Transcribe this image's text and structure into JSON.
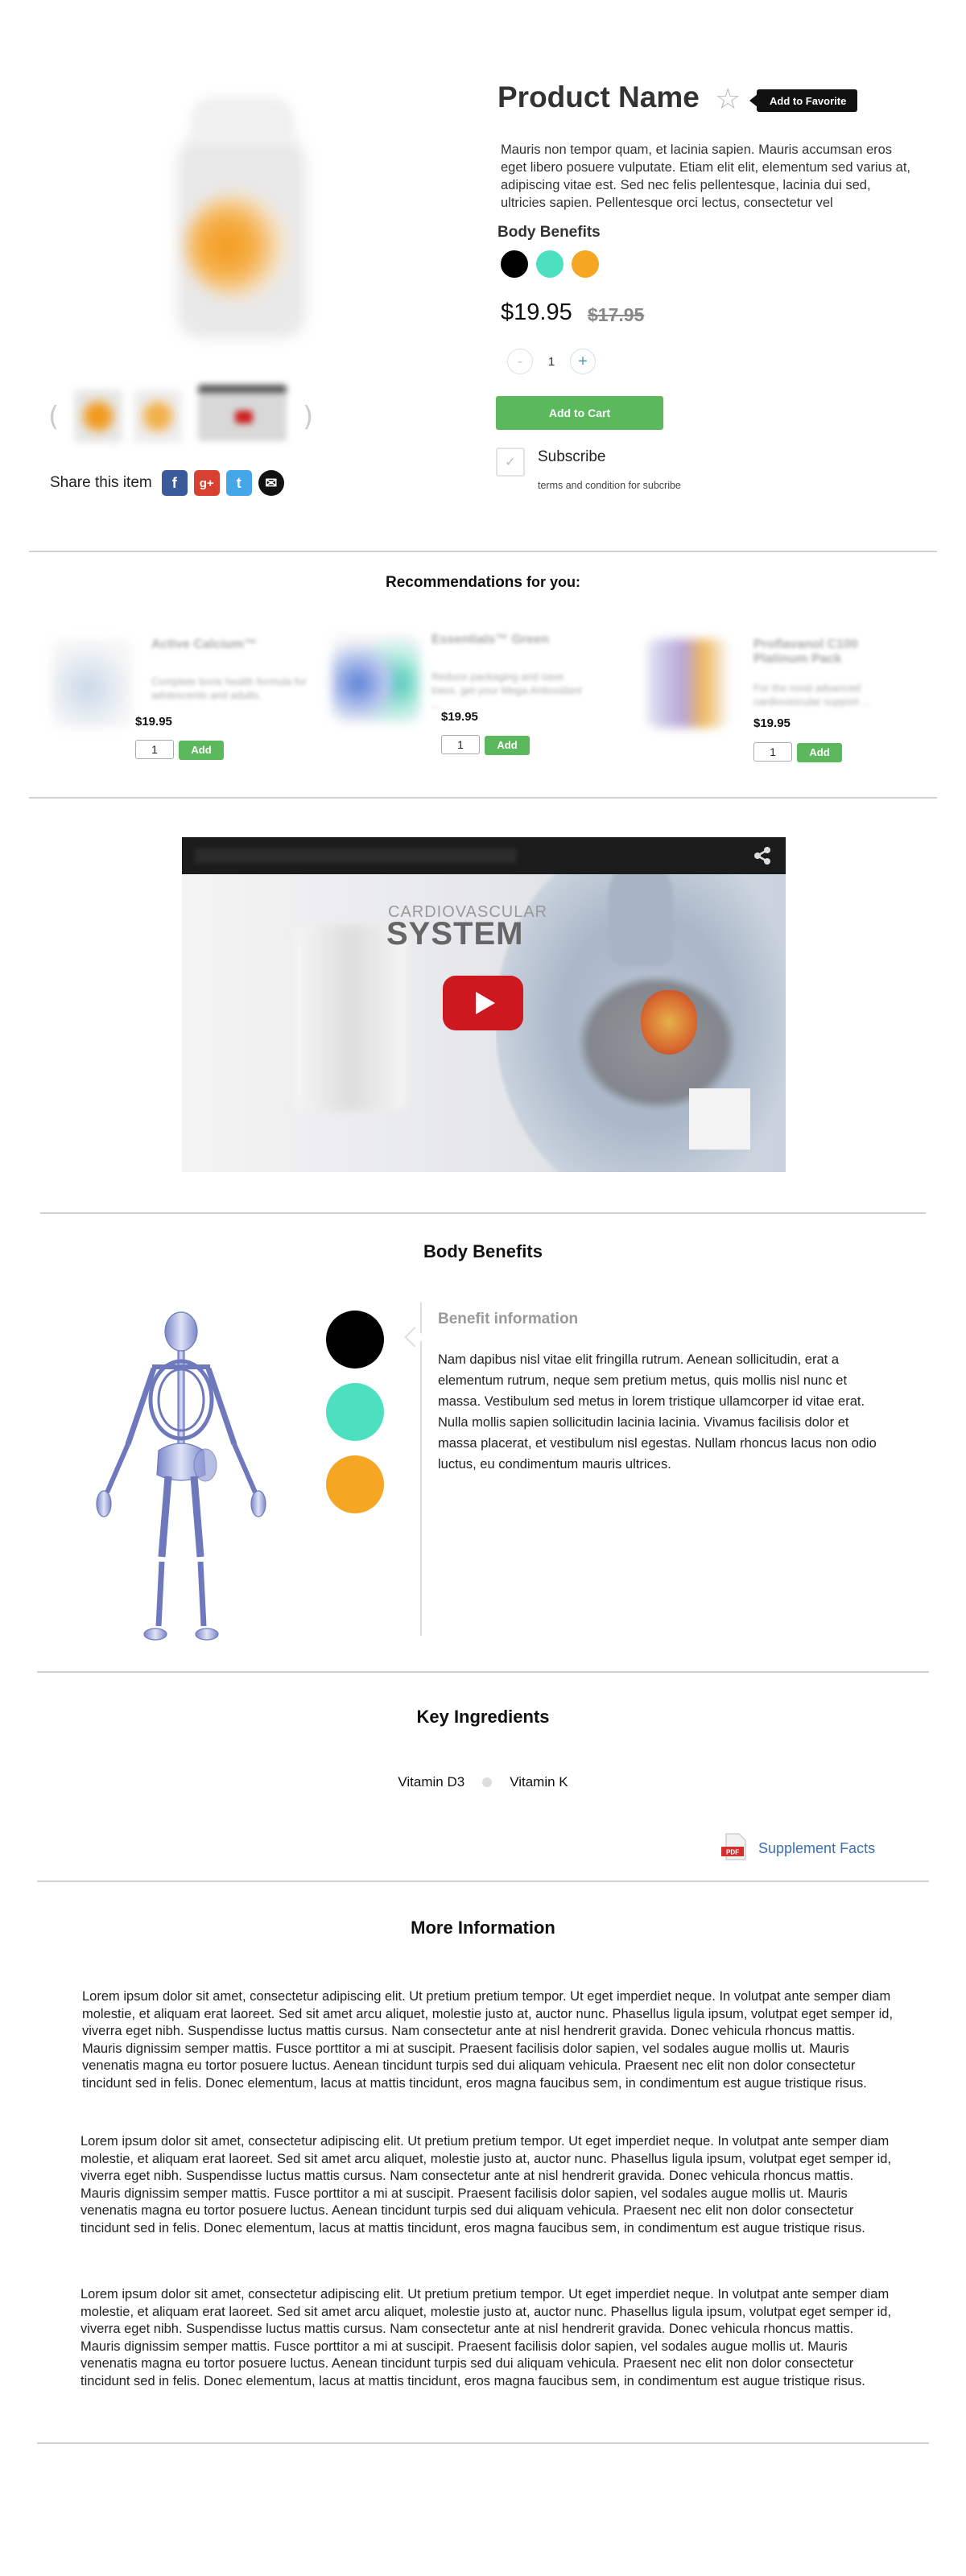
{
  "product": {
    "name": "Product Name",
    "favorite_label": "Add to Favorite",
    "description": "Mauris non tempor quam, et lacinia sapien. Mauris accumsan eros eget libero posuere vulputate. Etiam elit elit, elementum sed varius at, adipiscing vitae est. Sed nec felis pellentesque, lacinia dui sed, ultricies sapien. Pellentesque orci lectus, consectetur vel",
    "benefits_label": "Body Benefits",
    "swatches": [
      "#000000",
      "#4de0c0",
      "#f5a623"
    ],
    "price": "$19.95",
    "old_price": "$17.95",
    "qty_minus": "-",
    "qty_value": "1",
    "qty_plus": "+",
    "add_to_cart": "Add to Cart",
    "subscribe_label": "Subscribe",
    "subscribe_terms": "terms and condition for subcribe",
    "check_glyph": "✓"
  },
  "gallery": {
    "prev_arrow": "(",
    "next_arrow": ")"
  },
  "share": {
    "label": "Share this item",
    "icons": [
      "facebook-icon",
      "google-plus-icon",
      "twitter-icon",
      "email-icon"
    ],
    "fb": "f",
    "gp": "g+",
    "tw": "t",
    "em": "✉"
  },
  "recommendations": {
    "title_bold": "Recommendations",
    "title_rest": " for you:",
    "items": [
      {
        "name": "Active Calcium™",
        "blurb": "Complete bone health formula for adolescents and adults.",
        "price": "$19.95",
        "qty": "1",
        "add": "Add"
      },
      {
        "name": "Essentials™ Green",
        "blurb": "Reduce packaging and save trees, get your Mega Antioxidant ...",
        "price": "$19.95",
        "qty": "1",
        "add": "Add"
      },
      {
        "name": "Proflavanol C100 Platinum Pack",
        "blurb": "For the most advanced cardiovascular support ...",
        "price": "$19.95",
        "qty": "1",
        "add": "Add"
      }
    ]
  },
  "video": {
    "label_small": "CARDIOVASCULAR",
    "label_big": "SYSTEM"
  },
  "benefits": {
    "title": "Body Benefits",
    "circles": [
      "#000000",
      "#4de0c0",
      "#f5a623"
    ],
    "info_title": "Benefit information",
    "info_text": "Nam dapibus nisl vitae elit fringilla rutrum. Aenean sollicitudin, erat a elementum rutrum, neque sem pretium metus, quis mollis nisl nunc et massa. Vestibulum sed metus in lorem tristique ullamcorper id vitae erat. Nulla mollis sapien sollicitudin lacinia lacinia. Vivamus facilisis dolor et massa placerat, et vestibulum nisl egestas. Nullam rhoncus lacus non odio luctus, eu condimentum mauris ultrices."
  },
  "ingredients": {
    "title": "Key Ingredients",
    "items": [
      "Vitamin D3",
      "Vitamin K"
    ],
    "pdf_badge": "PDF",
    "supplement_link": "Supplement Facts"
  },
  "more_info": {
    "title": "More Information",
    "paragraphs": [
      "Lorem ipsum dolor sit amet, consectetur adipiscing elit. Ut pretium pretium tempor. Ut eget imperdiet neque. In volutpat ante semper diam molestie, et aliquam erat laoreet. Sed sit amet arcu aliquet, molestie justo at, auctor nunc. Phasellus ligula ipsum, volutpat eget semper id, viverra eget nibh. Suspendisse luctus mattis cursus. Nam consectetur ante at nisl hendrerit gravida. Donec vehicula rhoncus mattis. Mauris dignissim semper mattis. Fusce porttitor a mi at suscipit. Praesent facilisis dolor sapien, vel sodales augue mollis ut. Mauris venenatis magna eu tortor posuere luctus. Aenean tincidunt turpis sed dui aliquam vehicula. Praesent nec elit non dolor consectetur tincidunt sed in felis. Donec elementum, lacus at mattis tincidunt, eros magna faucibus sem, in condimentum est augue tristique risus.",
      "Lorem ipsum dolor sit amet, consectetur adipiscing elit. Ut pretium pretium tempor. Ut eget imperdiet neque. In volutpat ante semper diam molestie, et aliquam erat laoreet. Sed sit amet arcu aliquet, molestie justo at, auctor nunc. Phasellus ligula ipsum, volutpat eget semper id, viverra eget nibh. Suspendisse luctus mattis cursus. Nam consectetur ante at nisl hendrerit gravida. Donec vehicula rhoncus mattis. Mauris dignissim semper mattis. Fusce porttitor a mi at suscipit. Praesent facilisis dolor sapien, vel sodales augue mollis ut. Mauris venenatis magna eu tortor posuere luctus. Aenean tincidunt turpis sed dui aliquam vehicula. Praesent nec elit non dolor consectetur tincidunt sed in felis. Donec elementum, lacus at mattis tincidunt, eros magna faucibus sem, in condimentum est augue tristique risus.",
      "Lorem ipsum dolor sit amet, consectetur adipiscing elit. Ut pretium pretium tempor. Ut eget imperdiet neque. In volutpat ante semper diam molestie, et aliquam erat laoreet. Sed sit amet arcu aliquet, molestie justo at, auctor nunc. Phasellus ligula ipsum, volutpat eget semper id, viverra eget nibh. Suspendisse luctus mattis cursus. Nam consectetur ante at nisl hendrerit gravida. Donec vehicula rhoncus mattis. Mauris dignissim semper mattis. Fusce porttitor a mi at suscipit. Praesent facilisis dolor sapien, vel sodales augue mollis ut. Mauris venenatis magna eu tortor posuere luctus. Aenean tincidunt turpis sed dui aliquam vehicula. Praesent nec elit non dolor consectetur tincidunt sed in felis. Donec elementum, lacus at mattis tincidunt, eros magna faucibus sem, in condimentum est augue tristique risus."
    ]
  }
}
